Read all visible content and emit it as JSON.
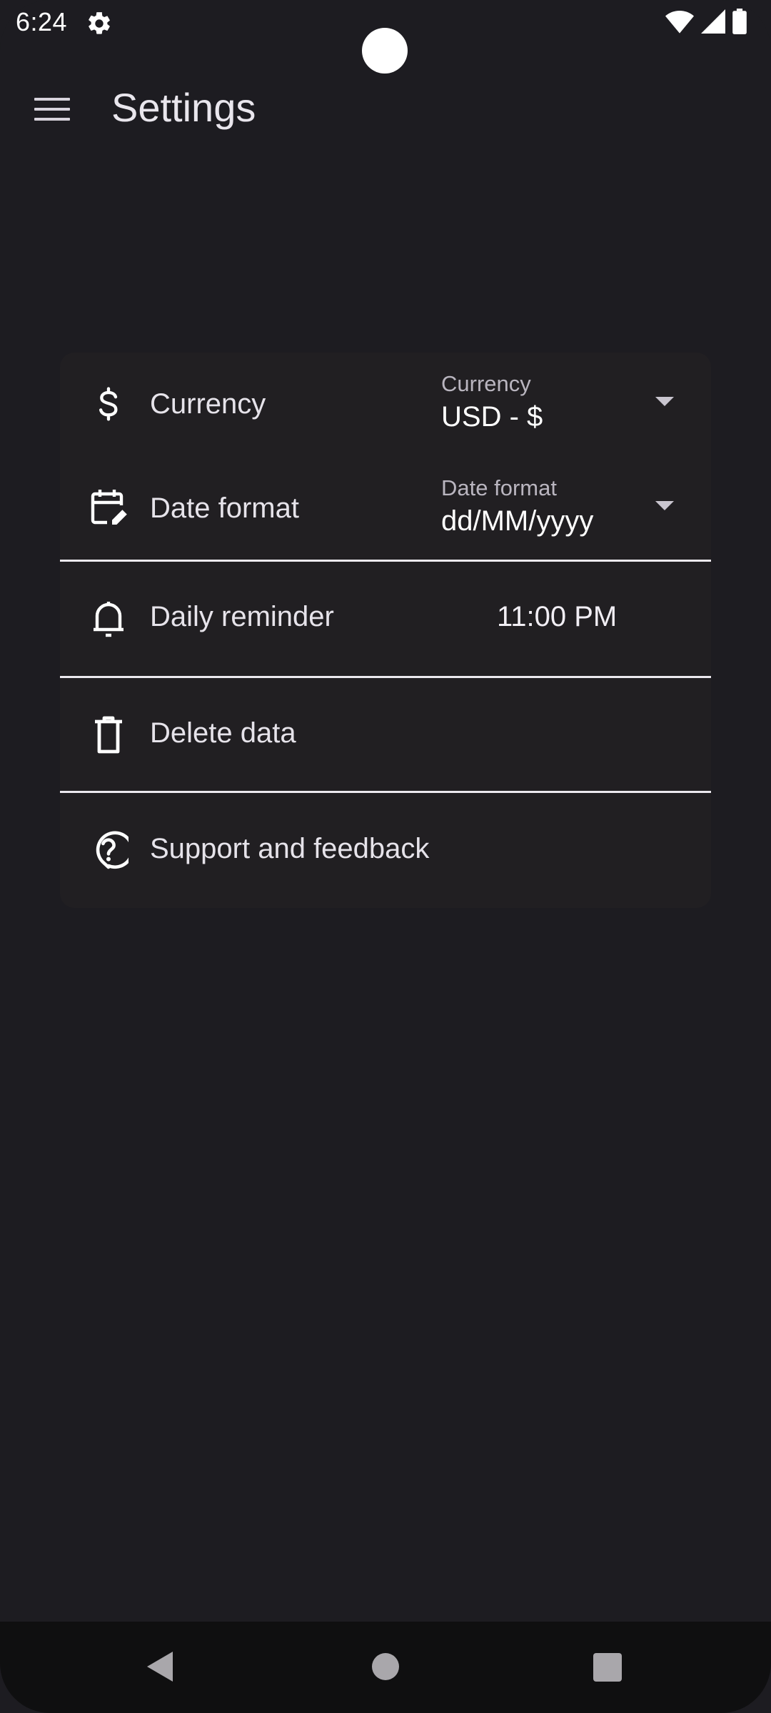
{
  "status_bar": {
    "time": "6:24",
    "settings_icon": "gear-icon",
    "icons": [
      "wifi-icon",
      "signal-icon",
      "battery-icon"
    ]
  },
  "app_bar": {
    "title": "Settings",
    "menu_icon": "menu-icon"
  },
  "settings": {
    "currency": {
      "label": "Currency",
      "icon": "dollar-icon",
      "field_label": "Currency",
      "value": "USD - $"
    },
    "date_format": {
      "label": "Date format",
      "icon": "calendar-edit-icon",
      "field_label": "Date format",
      "value": "dd/MM/yyyy"
    },
    "daily_reminder": {
      "label": "Daily reminder",
      "icon": "bell-icon",
      "value": "11:00 PM"
    },
    "delete_data": {
      "label": "Delete data",
      "icon": "trash-icon"
    },
    "support": {
      "label": "Support and feedback",
      "icon": "help-icon"
    }
  },
  "nav_bar": {
    "back": "back-icon",
    "home": "home-icon",
    "recents": "recents-icon"
  },
  "colors": {
    "background": "#1d1c21",
    "card": "#211f22",
    "divider": "#ece9ef",
    "nav_bar": "#0f0f10"
  }
}
